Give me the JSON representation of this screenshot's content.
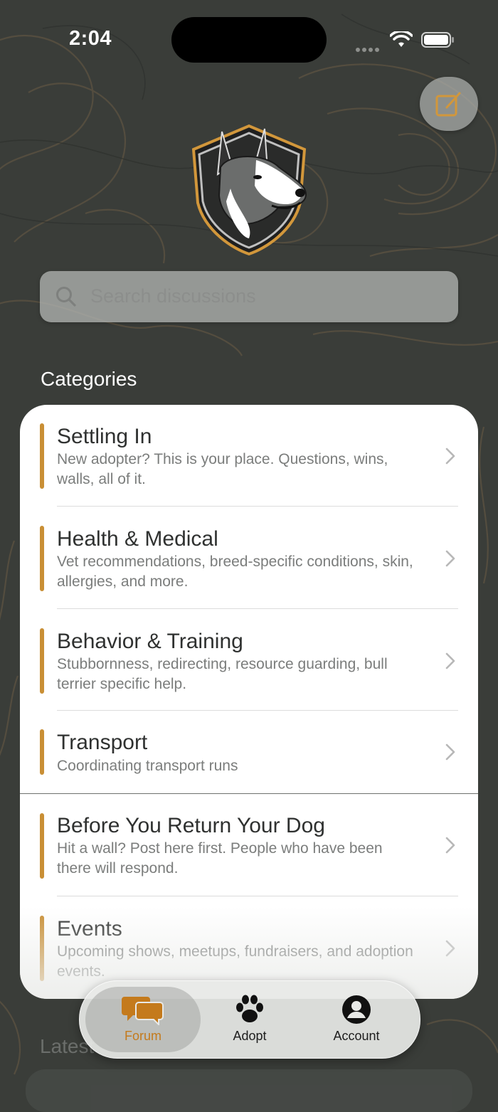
{
  "status_bar": {
    "time": "2:04"
  },
  "search": {
    "placeholder": "Search discussions"
  },
  "categories": {
    "title": "Categories",
    "items": [
      {
        "title": "Settling In",
        "description": "New adopter? This is your place. Questions, wins, walls, all of it."
      },
      {
        "title": "Health & Medical",
        "description": "Vet recommendations, breed-specific conditions, skin, allergies, and more."
      },
      {
        "title": "Behavior & Training",
        "description": "Stubbornness, redirecting, resource guarding, bull terrier specific help."
      },
      {
        "title": "Transport",
        "description": "Coordinating transport runs"
      },
      {
        "title": "Before You Return Your Dog",
        "description": "Hit a wall? Post here first. People who have been there will respond."
      },
      {
        "title": "Events",
        "description": "Upcoming shows, meetups, fundraisers, and adoption events."
      }
    ]
  },
  "latest": {
    "title": "Latest"
  },
  "tab_bar": {
    "tabs": [
      {
        "label": "Forum",
        "icon": "forum-bubbles-icon",
        "active": true
      },
      {
        "label": "Adopt",
        "icon": "paw-icon",
        "active": false
      },
      {
        "label": "Account",
        "icon": "account-icon",
        "active": false
      }
    ]
  },
  "colors": {
    "accent": "#c98f35",
    "background": "#3a3d39",
    "card": "#ffffff",
    "tab_active": "#c47a1c"
  }
}
